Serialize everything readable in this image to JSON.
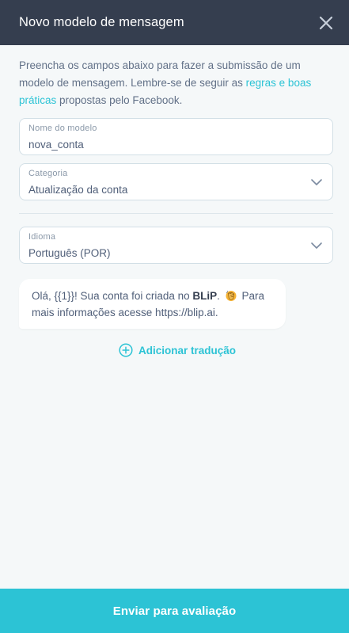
{
  "header": {
    "title": "Novo modelo de mensagem",
    "close_icon": "close-icon"
  },
  "intro": {
    "text_before": "Preencha os campos abaixo para fazer a submissão de um modelo de mensagem. Lembre-se de seguir as ",
    "link_text": "regras e boas práticas",
    "text_after": " propostas pelo Facebook."
  },
  "fields": {
    "name": {
      "label": "Nome do modelo",
      "value": "nova_conta"
    },
    "category": {
      "label": "Categoria",
      "value": "Atualização da conta"
    },
    "language": {
      "label": "Idioma",
      "value": "Português (POR)"
    }
  },
  "message": {
    "part1": "Olá, {{1}}! Sua conta foi criada no ",
    "brand": "BLiP",
    "part2": ". ",
    "emoji": "clapping-hands-icon",
    "part3": " Para mais informações acesse https://blip.ai."
  },
  "add_translation": {
    "label": "Adicionar tradução"
  },
  "footer": {
    "submit_label": "Enviar para avaliação"
  },
  "colors": {
    "accent": "#2cc3d5",
    "header_bg": "#353e4f",
    "background": "#f5f8f9"
  }
}
